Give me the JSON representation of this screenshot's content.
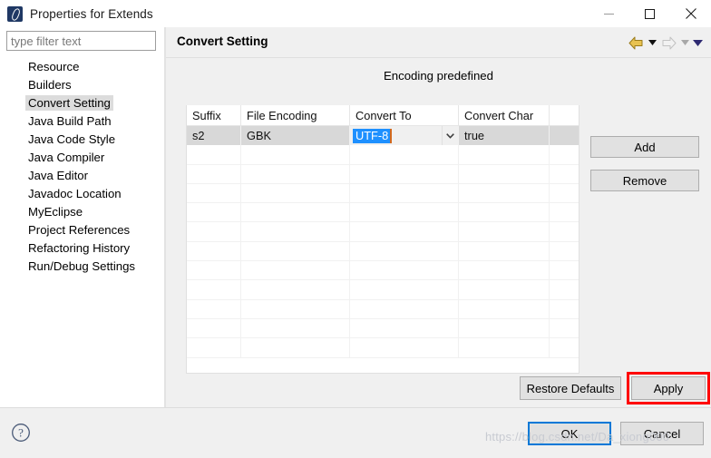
{
  "window": {
    "title": "Properties for Extends",
    "icon": "eclipse-properties-icon",
    "controls": {
      "minimize": "minimize-icon",
      "maximize": "maximize-icon",
      "close": "close-icon"
    }
  },
  "sidebar": {
    "filter": {
      "value": "",
      "placeholder": "type filter text"
    },
    "items": [
      {
        "label": "Resource",
        "selected": false
      },
      {
        "label": "Builders",
        "selected": false
      },
      {
        "label": "Convert Setting",
        "selected": true
      },
      {
        "label": "Java Build Path",
        "selected": false
      },
      {
        "label": "Java Code Style",
        "selected": false
      },
      {
        "label": "Java Compiler",
        "selected": false
      },
      {
        "label": "Java Editor",
        "selected": false
      },
      {
        "label": "Javadoc Location",
        "selected": false
      },
      {
        "label": "MyEclipse",
        "selected": false
      },
      {
        "label": "Project References",
        "selected": false
      },
      {
        "label": "Refactoring History",
        "selected": false
      },
      {
        "label": "Run/Debug Settings",
        "selected": false
      }
    ]
  },
  "page": {
    "title": "Convert Setting",
    "section_label": "Encoding predefined",
    "nav": {
      "back": "back-arrow-icon",
      "back_menu": "back-dropdown-icon",
      "forward": "forward-arrow-icon",
      "forward_menu": "forward-dropdown-icon",
      "menu": "view-menu-icon"
    }
  },
  "table": {
    "columns": [
      "Suffix",
      "File Encoding",
      "Convert To",
      "Convert Char",
      ""
    ],
    "rows": [
      {
        "suffix": "s2",
        "file_encoding": "GBK",
        "convert_to": "UTF-8",
        "convert_char": "true",
        "extra": "",
        "selected": true,
        "editing_cell": "convert_to"
      }
    ],
    "empty_row_count": 11
  },
  "side_buttons": {
    "add": "Add",
    "remove": "Remove"
  },
  "pane_buttons": {
    "restore_defaults": "Restore Defaults",
    "apply": "Apply"
  },
  "footer": {
    "help": "help-icon",
    "ok": "OK",
    "cancel": "Cancel"
  },
  "watermark": "https://blog.csdn.net/Da_xiong000",
  "colors": {
    "accent_blue": "#0078d7",
    "selection_blue": "#1e90ff",
    "highlight_red": "#ff0000",
    "row_selected": "#d8d8d8",
    "tree_selected": "#dcdcdc",
    "dialog_bg": "#f0f0f0",
    "back_arrow": "#e8c250",
    "forward_arrow": "#d4d4d4",
    "menu_arrow": "#2e2a72"
  }
}
